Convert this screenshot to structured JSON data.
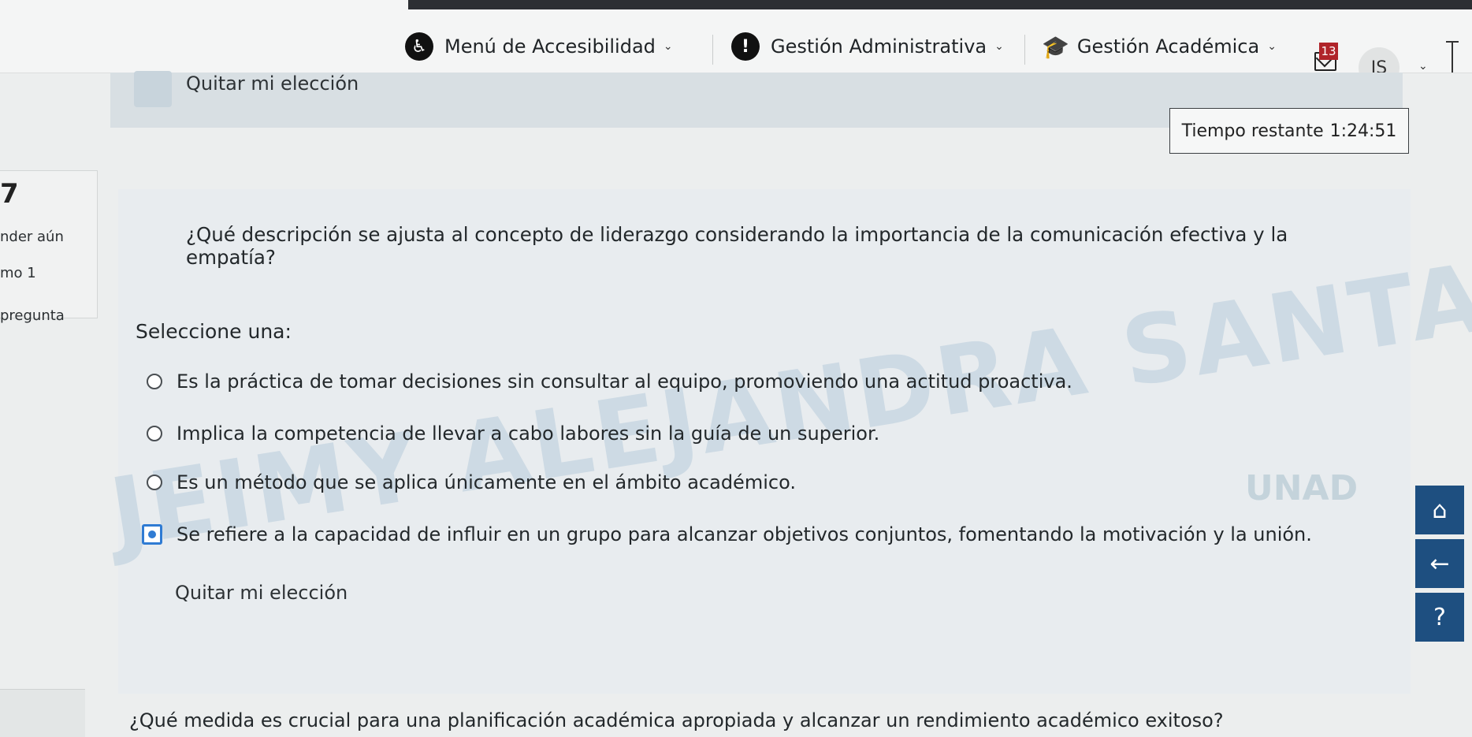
{
  "topbar": {
    "accessibility_label": "Menú de Accesibilidad",
    "admin_label": "Gestión Administrativa",
    "academic_label": "Gestión Académica",
    "messages_count": "13",
    "user_initials": "JS"
  },
  "remove_choice_top": "Quitar mi elección",
  "timer": {
    "label": "Tiempo restante",
    "value": "1:24:51"
  },
  "question_info": {
    "number": "7",
    "status": "nder aún",
    "mark": "mo 1",
    "flag": "pregunta"
  },
  "watermark": "JEIMY ALEJANDRA SANTANA",
  "question": {
    "text": "¿Qué descripción se ajusta al concepto de liderazgo considerando la importancia de la comunicación efectiva y la empatía?",
    "prompt": "Seleccione una:",
    "options": [
      {
        "label": "Es la práctica de tomar decisiones sin consultar al equipo, promoviendo una actitud proactiva.",
        "checked": false
      },
      {
        "label": "Implica la competencia de llevar a cabo labores sin la guía de un superior.",
        "checked": false
      },
      {
        "label": "Es un método que se aplica únicamente en el ámbito académico.",
        "checked": false
      },
      {
        "label": "Se refiere a la capacidad de influir en un grupo para alcanzar objetivos conjuntos, fomentando la motivación y la unión.",
        "checked": true
      }
    ],
    "remove_choice": "Quitar mi elección"
  },
  "next_question_text": "¿Qué medida es crucial para una planificación académica apropiada y alcanzar un rendimiento académico exitoso?",
  "side_buttons": {
    "home": "home-icon",
    "back": "arrow-left-icon",
    "help": "help-icon"
  }
}
